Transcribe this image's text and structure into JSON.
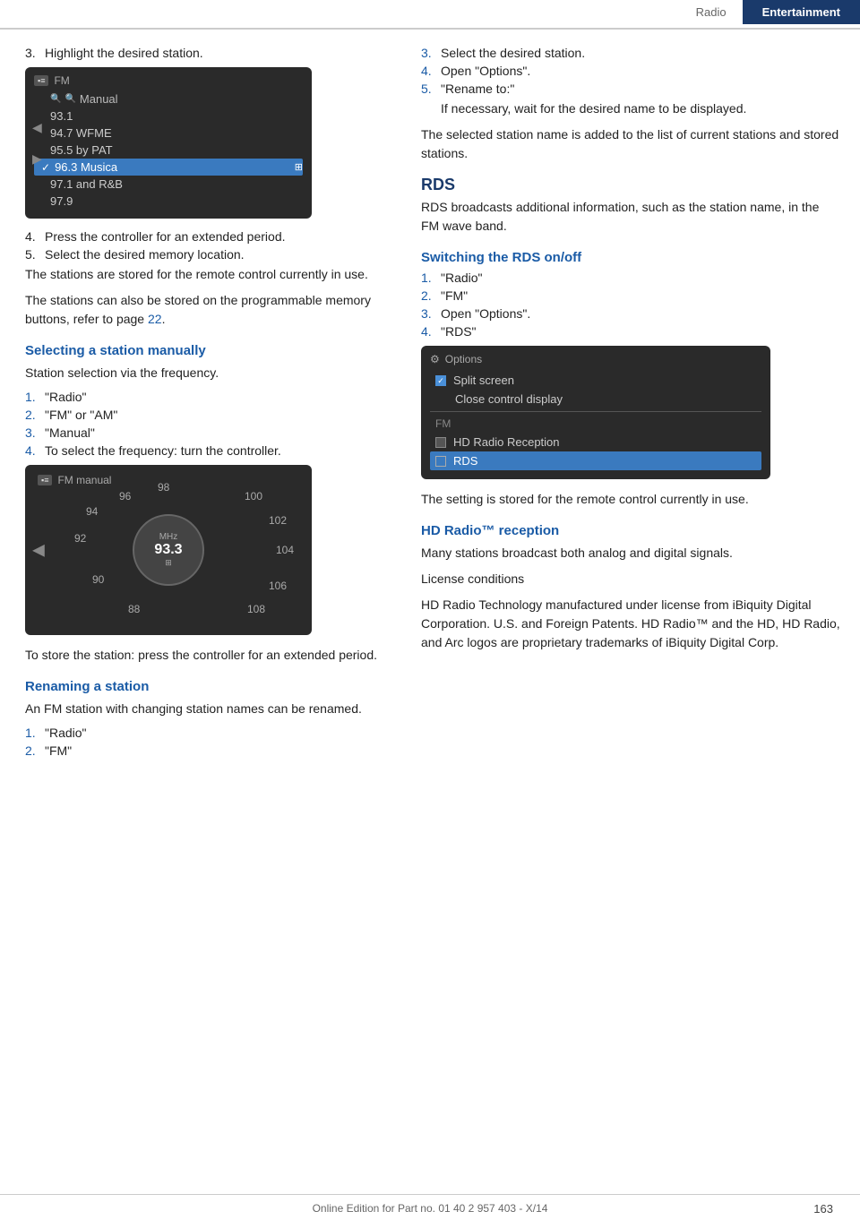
{
  "header": {
    "radio_label": "Radio",
    "entertainment_label": "Entertainment"
  },
  "left_col": {
    "step3": {
      "num": "3.",
      "text": "Highlight the desired station."
    },
    "screen1": {
      "fm_label": "FM",
      "items": [
        {
          "text": "Manual",
          "type": "manual"
        },
        {
          "text": "93.1",
          "type": "normal"
        },
        {
          "text": "94.7 WFME",
          "type": "normal"
        },
        {
          "text": "95.5 by PAT",
          "type": "normal"
        },
        {
          "text": "96.3 Musica",
          "type": "selected"
        },
        {
          "text": "97.1 and R&B",
          "type": "normal"
        },
        {
          "text": "97.9",
          "type": "normal"
        }
      ]
    },
    "step4": {
      "num": "4.",
      "text": "Press the controller for an extended period."
    },
    "step5": {
      "num": "5.",
      "text": "Select the desired memory location."
    },
    "para1": "The stations are stored for the remote control currently in use.",
    "para2": "The stations can also be stored on the programmable memory buttons, refer to page 22.",
    "section_selecting": "Selecting a station manually",
    "para_selecting": "Station selection via the frequency.",
    "sel_steps": [
      {
        "num": "1.",
        "text": "\"Radio\""
      },
      {
        "num": "2.",
        "text": "\"FM\" or \"AM\""
      },
      {
        "num": "3.",
        "text": "\"Manual\""
      },
      {
        "num": "4.",
        "text": "To select the frequency: turn the controller."
      }
    ],
    "screen2": {
      "header": "FM manual",
      "freq": "93.3",
      "unit": "MHz",
      "labels": [
        {
          "text": "88",
          "pos": "bottom-left"
        },
        {
          "text": "90",
          "pos": "mid-left"
        },
        {
          "text": "92",
          "pos": "left"
        },
        {
          "text": "94",
          "pos": "upper-left"
        },
        {
          "text": "96",
          "pos": "top-left"
        },
        {
          "text": "98",
          "pos": "top"
        },
        {
          "text": "100",
          "pos": "top-right"
        },
        {
          "text": "102",
          "pos": "right-upper"
        },
        {
          "text": "104",
          "pos": "right"
        },
        {
          "text": "106",
          "pos": "right-lower"
        },
        {
          "text": "108",
          "pos": "bottom-right"
        }
      ]
    },
    "para_store": "To store the station: press the controller for an extended period.",
    "section_renaming": "Renaming a station",
    "para_renaming": "An FM station with changing station names can be renamed.",
    "rename_steps": [
      {
        "num": "1.",
        "text": "\"Radio\""
      },
      {
        "num": "2.",
        "text": "\"FM\""
      }
    ]
  },
  "right_col": {
    "rename_steps_cont": [
      {
        "num": "3.",
        "text": "Select the desired station."
      },
      {
        "num": "4.",
        "text": "Open \"Options\"."
      },
      {
        "num": "5.",
        "text": "\"Rename to:\""
      }
    ],
    "rename_para": "If necessary, wait for the desired name to be displayed.",
    "para_selected": "The selected station name is added to the list of current stations and stored stations.",
    "rds_title": "RDS",
    "rds_para": "RDS broadcasts additional information, such as the station name, in the FM wave band.",
    "section_switching": "Switching the RDS on/off",
    "switch_steps": [
      {
        "num": "1.",
        "text": "\"Radio\""
      },
      {
        "num": "2.",
        "text": "\"FM\""
      },
      {
        "num": "3.",
        "text": "Open \"Options\"."
      },
      {
        "num": "4.",
        "text": "\"RDS\""
      }
    ],
    "options_screen": {
      "header": "Options",
      "items": [
        {
          "type": "checked",
          "text": "Split screen"
        },
        {
          "type": "normal",
          "text": "Close control display"
        },
        {
          "type": "divider"
        },
        {
          "type": "fm-label",
          "text": "FM"
        },
        {
          "type": "unchecked",
          "text": "HD Radio Reception"
        },
        {
          "type": "highlighted",
          "text": "RDS"
        }
      ]
    },
    "para_setting": "The setting is stored for the remote control currently in use.",
    "section_hd": "HD Radio™ reception",
    "hd_para1": "Many stations broadcast both analog and digital signals.",
    "hd_para2": "License conditions",
    "hd_para3": "HD Radio Technology manufactured under license from iBiquity Digital Corporation. U.S. and Foreign Patents. HD Radio™ and the HD, HD Radio, and Arc logos are proprietary trademarks of iBiquity Digital Corp."
  },
  "footer": {
    "text": "Online Edition for Part no. 01 40 2 957 403 - X/14",
    "page_num": "163"
  }
}
